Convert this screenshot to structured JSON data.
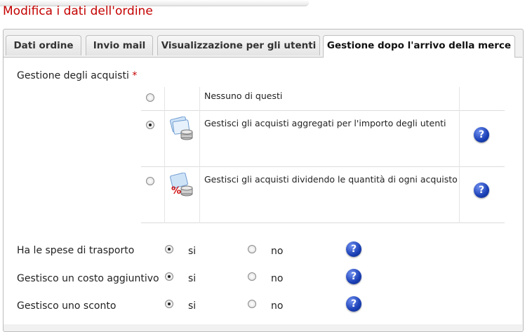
{
  "page_title": "Modifica i dati dell'ordine",
  "tabs": [
    {
      "label": "Dati ordine",
      "active": false
    },
    {
      "label": "Invio mail",
      "active": false
    },
    {
      "label": "Visualizzazione per gli utenti",
      "active": false
    },
    {
      "label": "Gestione dopo l'arrivo della merce",
      "active": true
    }
  ],
  "purchases": {
    "label": "Gestione degli acquisti",
    "required_mark": "*",
    "options": [
      {
        "label": "Nessuno di questi",
        "selected": false,
        "icon": null
      },
      {
        "label": "Gestisci gli acquisti aggregati per l'importo degli utenti",
        "selected": true,
        "icon": "coins-stack-icon"
      },
      {
        "label": "Gestisci gli acquisti dividendo le quantità di ogni acquisto",
        "selected": false,
        "icon": "percent-coins-icon"
      }
    ]
  },
  "settings": [
    {
      "label": "Ha le spese di trasporto",
      "yes": "si",
      "no": "no",
      "value": "si"
    },
    {
      "label": "Gestisco un costo aggiuntivo",
      "yes": "si",
      "no": "no",
      "value": "si"
    },
    {
      "label": "Gestisco uno sconto",
      "yes": "si",
      "no": "no",
      "value": "si"
    }
  ],
  "help_icon": "?",
  "colors": {
    "title": "#c40000",
    "required": "#c40000",
    "help": "#1a3fb5"
  }
}
